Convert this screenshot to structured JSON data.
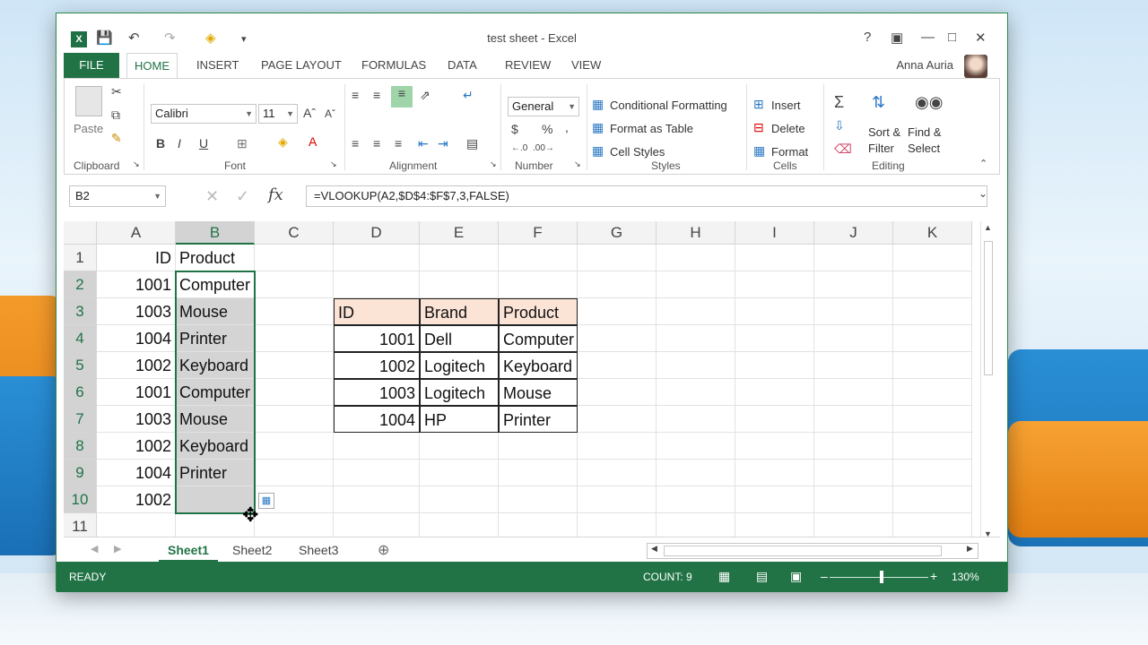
{
  "window": {
    "title": "test sheet - Excel"
  },
  "user": {
    "name": "Anna Auria"
  },
  "tabs": [
    {
      "label": "FILE"
    },
    {
      "label": "HOME"
    },
    {
      "label": "INSERT"
    },
    {
      "label": "PAGE LAYOUT"
    },
    {
      "label": "FORMULAS"
    },
    {
      "label": "DATA"
    },
    {
      "label": "REVIEW"
    },
    {
      "label": "VIEW"
    }
  ],
  "ribbon": {
    "clipboard": {
      "paste": "Paste",
      "label": "Clipboard"
    },
    "font": {
      "name": "Calibri",
      "size": "11",
      "label": "Font",
      "bold": "B",
      "italic": "I",
      "underline": "U"
    },
    "alignment": {
      "label": "Alignment"
    },
    "number": {
      "format": "General",
      "currency": "$",
      "percent": "%",
      "comma": ",",
      "label": "Number"
    },
    "styles": {
      "conditional": "Conditional Formatting",
      "format_table": "Format as Table",
      "cell_styles": "Cell Styles",
      "label": "Styles"
    },
    "cells": {
      "insert": "Insert",
      "delete": "Delete",
      "format": "Format",
      "label": "Cells"
    },
    "editing": {
      "sort_line1": "Sort &",
      "sort_line2": "Filter",
      "find_line1": "Find &",
      "find_line2": "Select",
      "label": "Editing"
    }
  },
  "formula_bar": {
    "name_box": "B2",
    "fx": "fx",
    "formula": "=VLOOKUP(A2,$D$4:$F$7,3,FALSE)"
  },
  "columns": [
    "A",
    "B",
    "C",
    "D",
    "E",
    "F",
    "G",
    "H",
    "I",
    "J",
    "K"
  ],
  "rows": [
    "1",
    "2",
    "3",
    "4",
    "5",
    "6",
    "7",
    "8",
    "9",
    "10",
    "11"
  ],
  "cells": {
    "A1": "ID",
    "B1": "Product",
    "A2": "1001",
    "B2": "Computer",
    "A3": "1003",
    "B3": "Mouse",
    "A4": "1004",
    "B4": "Printer",
    "A5": "1002",
    "B5": "Keyboard",
    "A6": "1001",
    "B6": "Computer",
    "A7": "1003",
    "B7": "Mouse",
    "A8": "1002",
    "B8": "Keyboard",
    "A9": "1004",
    "B9": "Printer",
    "A10": "1002",
    "D3": "ID",
    "E3": "Brand",
    "F3": "Product",
    "D4": "1001",
    "E4": "Dell",
    "F4": "Computer",
    "D5": "1002",
    "E5": "Logitech",
    "F5": "Keyboard",
    "D6": "1003",
    "E6": "Logitech",
    "F6": "Mouse",
    "D7": "1004",
    "E7": "HP",
    "F7": "Printer"
  },
  "sheets": [
    "Sheet1",
    "Sheet2",
    "Sheet3"
  ],
  "status": {
    "mode": "READY",
    "count": "COUNT: 9",
    "zoom": "130%"
  },
  "colors": {
    "accent": "#217346",
    "table_header": "#fbe3d6",
    "selection": "#d4d4d4"
  }
}
